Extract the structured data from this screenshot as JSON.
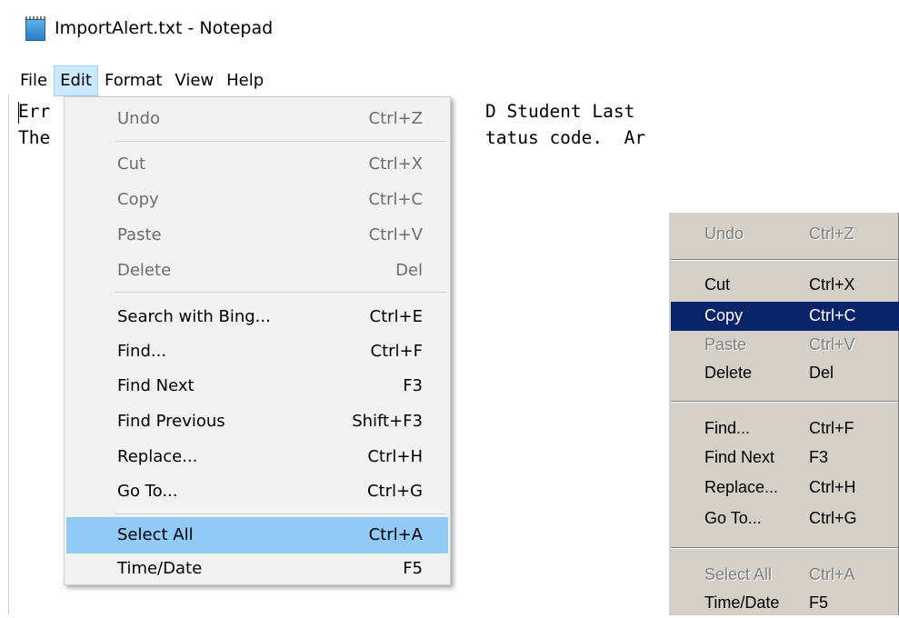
{
  "window": {
    "title": "ImportAlert.txt - Notepad"
  },
  "menubar": {
    "items": [
      "File",
      "Edit",
      "Format",
      "View",
      "Help"
    ]
  },
  "editor": {
    "lines": [
      "Err",
      "The"
    ],
    "lines_visible_right": [
      "D Student Last",
      "tatus code.  Ar"
    ]
  },
  "edit_menu": {
    "items": [
      {
        "label": "Undo",
        "shortcut": "Ctrl+Z",
        "state": "disabled"
      },
      {
        "label": "Cut",
        "shortcut": "Ctrl+X",
        "state": "disabled"
      },
      {
        "label": "Copy",
        "shortcut": "Ctrl+C",
        "state": "disabled"
      },
      {
        "label": "Paste",
        "shortcut": "Ctrl+V",
        "state": "disabled"
      },
      {
        "label": "Delete",
        "shortcut": "Del",
        "state": "disabled"
      },
      {
        "label": "Search with Bing...",
        "shortcut": "Ctrl+E",
        "state": "enabled"
      },
      {
        "label": "Find...",
        "shortcut": "Ctrl+F",
        "state": "enabled"
      },
      {
        "label": "Find Next",
        "shortcut": "F3",
        "state": "enabled"
      },
      {
        "label": "Find Previous",
        "shortcut": "Shift+F3",
        "state": "enabled"
      },
      {
        "label": "Replace...",
        "shortcut": "Ctrl+H",
        "state": "enabled"
      },
      {
        "label": "Go To...",
        "shortcut": "Ctrl+G",
        "state": "enabled"
      },
      {
        "label": "Select All",
        "shortcut": "Ctrl+A",
        "state": "highlighted"
      },
      {
        "label": "Time/Date",
        "shortcut": "F5",
        "state": "enabled"
      }
    ]
  },
  "classic_menu": {
    "items": [
      {
        "label": "Undo",
        "shortcut": "Ctrl+Z",
        "state": "disabled"
      },
      {
        "label": "Cut",
        "shortcut": "Ctrl+X",
        "state": "enabled"
      },
      {
        "label": "Copy",
        "shortcut": "Ctrl+C",
        "state": "highlighted"
      },
      {
        "label": "Paste",
        "shortcut": "Ctrl+V",
        "state": "disabled"
      },
      {
        "label": "Delete",
        "shortcut": "Del",
        "state": "enabled"
      },
      {
        "label": "Find...",
        "shortcut": "Ctrl+F",
        "state": "enabled"
      },
      {
        "label": "Find Next",
        "shortcut": "F3",
        "state": "enabled"
      },
      {
        "label": "Replace...",
        "shortcut": "Ctrl+H",
        "state": "enabled"
      },
      {
        "label": "Go To...",
        "shortcut": "Ctrl+G",
        "state": "enabled"
      },
      {
        "label": "Select All",
        "shortcut": "Ctrl+A",
        "state": "disabled"
      },
      {
        "label": "Time/Date",
        "shortcut": "F5",
        "state": "enabled"
      }
    ]
  },
  "colors": {
    "menu_open_bg": "#cce8ff",
    "win10_highlight": "#91c9f7",
    "classic_highlight": "#0a246a",
    "classic_face": "#d4d0c8"
  }
}
